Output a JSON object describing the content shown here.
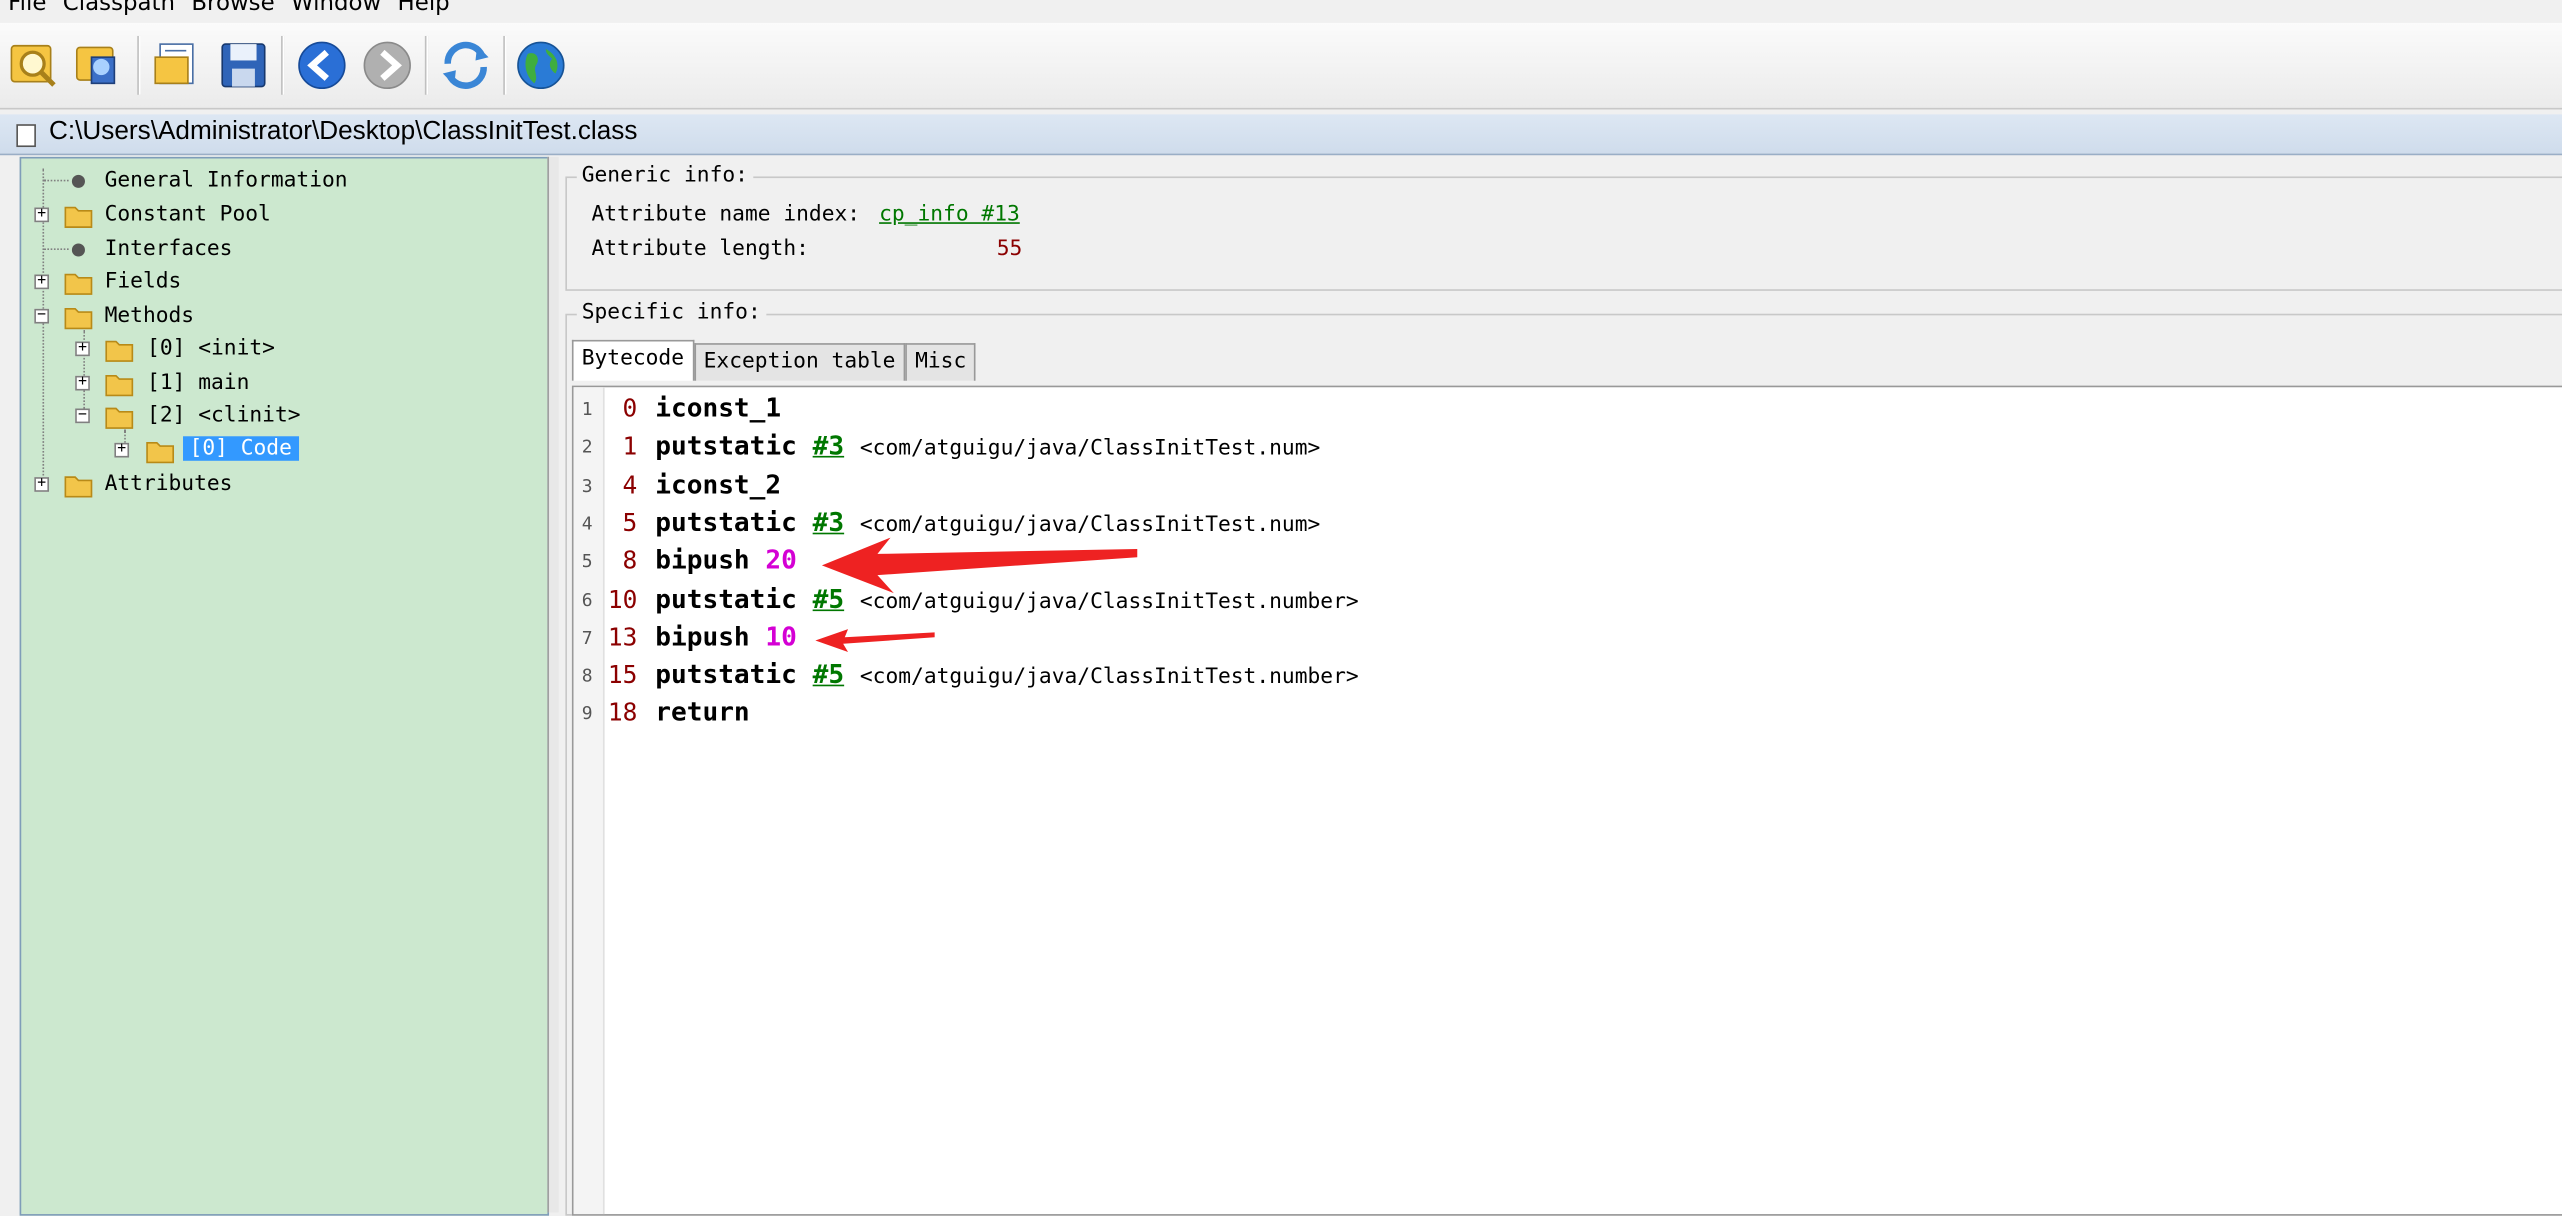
{
  "menu": [
    "File",
    "Classpath",
    "Browse",
    "Window",
    "Help"
  ],
  "window_title": "C:\\Users\\Administrator\\Desktop\\ClassInitTest.class",
  "toolbar": [
    {
      "name": "open-class-icon"
    },
    {
      "name": "open-jar-icon"
    },
    {
      "name": "open-folder-icon"
    },
    {
      "name": "save-icon"
    },
    {
      "name": "back-icon"
    },
    {
      "name": "forward-icon"
    },
    {
      "name": "reload-icon"
    },
    {
      "name": "web-icon"
    }
  ],
  "tree": {
    "general": "General Information",
    "constant_pool": "Constant Pool",
    "interfaces": "Interfaces",
    "fields": "Fields",
    "methods": "Methods",
    "method0": "[0] <init>",
    "method1": "[1] main",
    "method2": "[2] <clinit>",
    "code": "[0] Code",
    "attributes": "Attributes"
  },
  "generic": {
    "legend": "Generic info:",
    "name_index_label": "Attribute name index:",
    "name_index_value": "cp_info #13",
    "length_label": "Attribute length:",
    "length_value": "55"
  },
  "specific": {
    "legend": "Specific info:",
    "tabs": [
      "Bytecode",
      "Exception table",
      "Misc"
    ]
  },
  "bytecode": [
    {
      "ln": "1",
      "offset": "0",
      "op": "iconst_1",
      "ref": "",
      "comment": "",
      "literal": ""
    },
    {
      "ln": "2",
      "offset": "1",
      "op": "putstatic",
      "ref": "#3",
      "comment": "<com/atguigu/java/ClassInitTest.num>",
      "literal": ""
    },
    {
      "ln": "3",
      "offset": "4",
      "op": "iconst_2",
      "ref": "",
      "comment": "",
      "literal": ""
    },
    {
      "ln": "4",
      "offset": "5",
      "op": "putstatic",
      "ref": "#3",
      "comment": "<com/atguigu/java/ClassInitTest.num>",
      "literal": ""
    },
    {
      "ln": "5",
      "offset": "8",
      "op": "bipush",
      "ref": "",
      "comment": "",
      "literal": "20"
    },
    {
      "ln": "6",
      "offset": "10",
      "op": "putstatic",
      "ref": "#5",
      "comment": "<com/atguigu/java/ClassInitTest.number>",
      "literal": ""
    },
    {
      "ln": "7",
      "offset": "13",
      "op": "bipush",
      "ref": "",
      "comment": "",
      "literal": "10"
    },
    {
      "ln": "8",
      "offset": "15",
      "op": "putstatic",
      "ref": "#5",
      "comment": "<com/atguigu/java/ClassInitTest.number>",
      "literal": ""
    },
    {
      "ln": "9",
      "offset": "18",
      "op": "return",
      "ref": "",
      "comment": "",
      "literal": ""
    }
  ],
  "colors": {
    "tree_bg": "#cce8cf",
    "selection": "#3399ff",
    "literal": "#d400d4",
    "reference": "#007700",
    "annotation_arrow": "#ee2222"
  }
}
